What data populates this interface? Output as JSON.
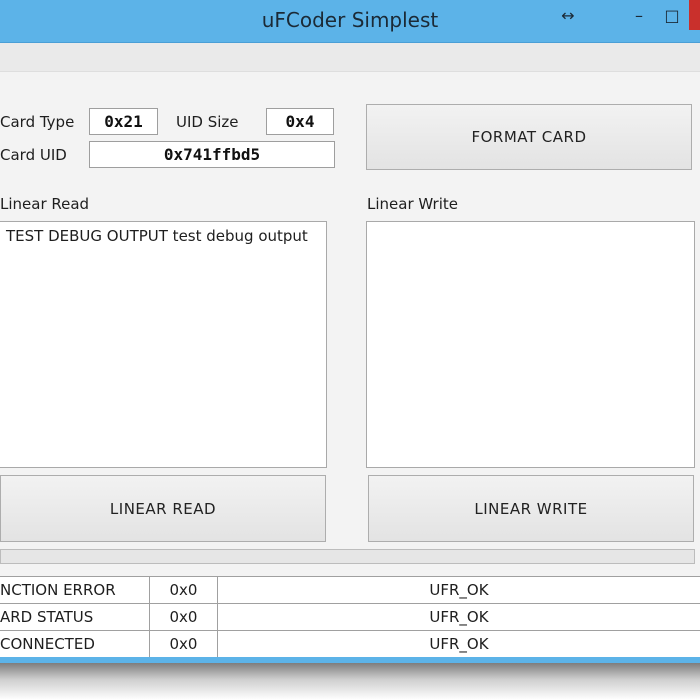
{
  "window": {
    "title": "uFCoder Simplest",
    "restore_glyph": "↔",
    "minimize_glyph": "–",
    "maximize_glyph": "□"
  },
  "card_info": {
    "card_type_label": "Card Type",
    "card_type_value": "0x21",
    "uid_size_label": "UID Size",
    "uid_size_value": "0x4",
    "card_uid_label": "Card UID",
    "card_uid_value": "0x741ffbd5"
  },
  "buttons": {
    "format_card": "FORMAT CARD",
    "linear_read": "LINEAR READ",
    "linear_write": "LINEAR WRITE"
  },
  "linear_read": {
    "label": "Linear Read",
    "content": "TEST DEBUG OUTPUT test debug output"
  },
  "linear_write": {
    "label": "Linear Write",
    "content": ""
  },
  "progress": {
    "value": 0
  },
  "status_rows": [
    {
      "name": "NCTION ERROR",
      "code": "0x0",
      "status": "UFR_OK"
    },
    {
      "name": "ARD STATUS",
      "code": "0x0",
      "status": "UFR_OK"
    },
    {
      "name": "CONNECTED",
      "code": "0x0",
      "status": "UFR_OK"
    }
  ],
  "colors": {
    "titlebar": "#5cb3e8",
    "close_button": "#c9302c",
    "progress_fill": "#06b025"
  }
}
